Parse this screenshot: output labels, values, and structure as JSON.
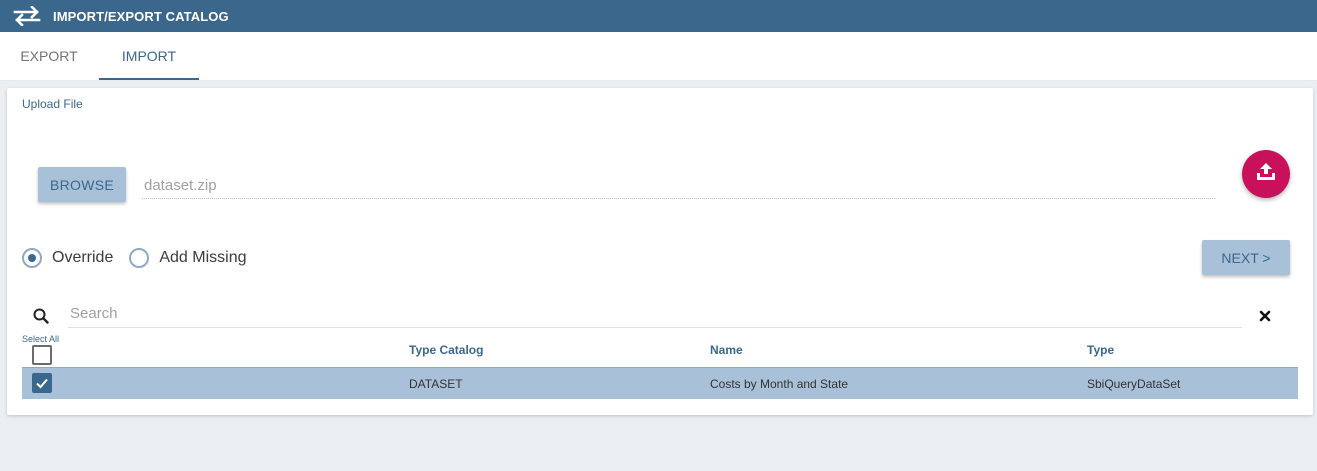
{
  "header": {
    "title": "IMPORT/EXPORT CATALOG",
    "icon": "swap-arrows-icon",
    "background": "#3b678c"
  },
  "tabs": [
    {
      "label": "EXPORT",
      "active": false
    },
    {
      "label": "IMPORT",
      "active": true
    }
  ],
  "upload": {
    "section_label": "Upload File",
    "browse_label": "BROWSE",
    "file_value": "dataset.zip",
    "upload_button_icon": "upload-icon",
    "upload_button_color": "#c8105b"
  },
  "options": {
    "override_label": "Override",
    "add_missing_label": "Add Missing",
    "selected": "Override"
  },
  "next_label": "NEXT >",
  "search": {
    "placeholder": "Search",
    "value": ""
  },
  "table": {
    "select_all_label": "Select All",
    "columns": [
      "Type Catalog",
      "Name",
      "Type"
    ],
    "rows": [
      {
        "checked": true,
        "type_catalog": "DATASET",
        "name": "Costs by Month and State",
        "type": "SbiQueryDataSet"
      }
    ]
  }
}
